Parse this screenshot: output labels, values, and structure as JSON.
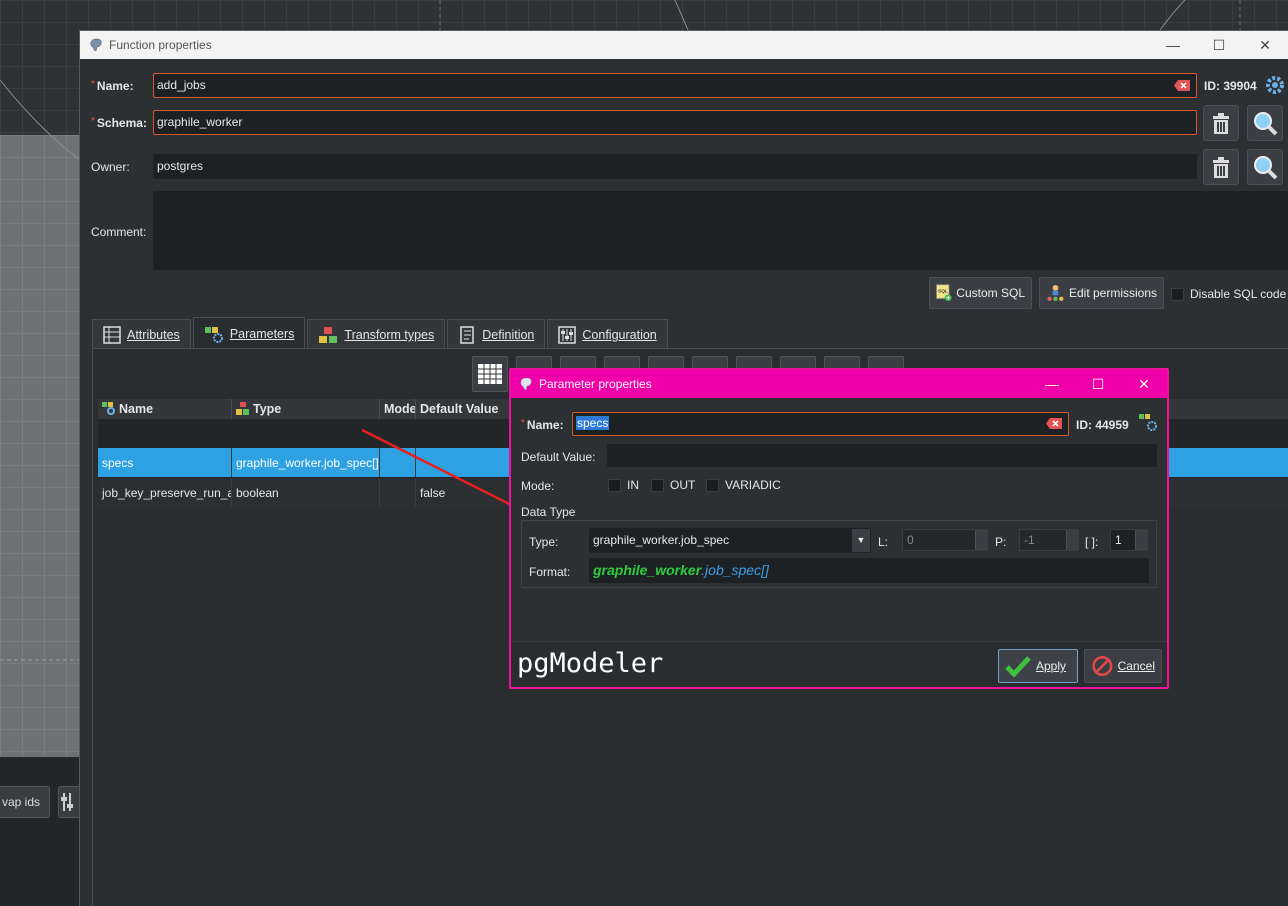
{
  "background": {
    "swap_ids_label": "vap ids"
  },
  "window": {
    "title": "Function properties",
    "name_label": "Name:",
    "name_value": "add_jobs",
    "id_label": "ID: 39904",
    "schema_label": "Schema:",
    "schema_value": "graphile_worker",
    "owner_label": "Owner:",
    "owner_value": "postgres",
    "comment_label": "Comment:",
    "comment_value": "",
    "custom_sql_label": "Custom SQL",
    "edit_permissions_label": "Edit permissions",
    "disable_sql_label": "Disable SQL code"
  },
  "tabs": [
    {
      "label": "Attributes",
      "icon": "attributes-icon"
    },
    {
      "label": "Parameters",
      "icon": "parameters-icon",
      "active": true
    },
    {
      "label": "Transform types",
      "icon": "transform-icon"
    },
    {
      "label": "Definition",
      "icon": "definition-icon"
    },
    {
      "label": "Configuration",
      "icon": "configuration-icon"
    }
  ],
  "grid": {
    "columns": [
      "Name",
      "Type",
      "Mode",
      "Default Value"
    ],
    "rows": [
      {
        "name": "specs",
        "type": "graphile_worker.job_spec[]",
        "mode": "",
        "default": ""
      },
      {
        "name": "job_key_preserve_run_at",
        "type": "boolean",
        "mode": "",
        "default": "false"
      }
    ]
  },
  "dialog": {
    "title": "Parameter properties",
    "name_label": "Name:",
    "name_value": "specs",
    "id_label": "ID: 44959",
    "default_value_label": "Default Value:",
    "default_value": "",
    "mode_label": "Mode:",
    "mode_in": "IN",
    "mode_out": "OUT",
    "mode_variadic": "VARIADIC",
    "data_type_label": "Data Type",
    "type_label": "Type:",
    "type_value": "graphile_worker.job_spec",
    "l_label": "L:",
    "l_value": "0",
    "p_label": "P:",
    "p_value": "-1",
    "dims_label": "[ ]:",
    "dims_value": "1",
    "format_label": "Format:",
    "format_schema": "graphile_worker",
    "format_type": ".job_spec[]",
    "brand": "pgModeler",
    "apply_label": "Apply",
    "cancel_label": "Cancel"
  },
  "colors": {
    "accent": "#f000a8",
    "selection": "#2ea1e2",
    "required_border": "#d8572a",
    "format_green": "#2ecc40",
    "format_blue": "#3a9ee8"
  }
}
